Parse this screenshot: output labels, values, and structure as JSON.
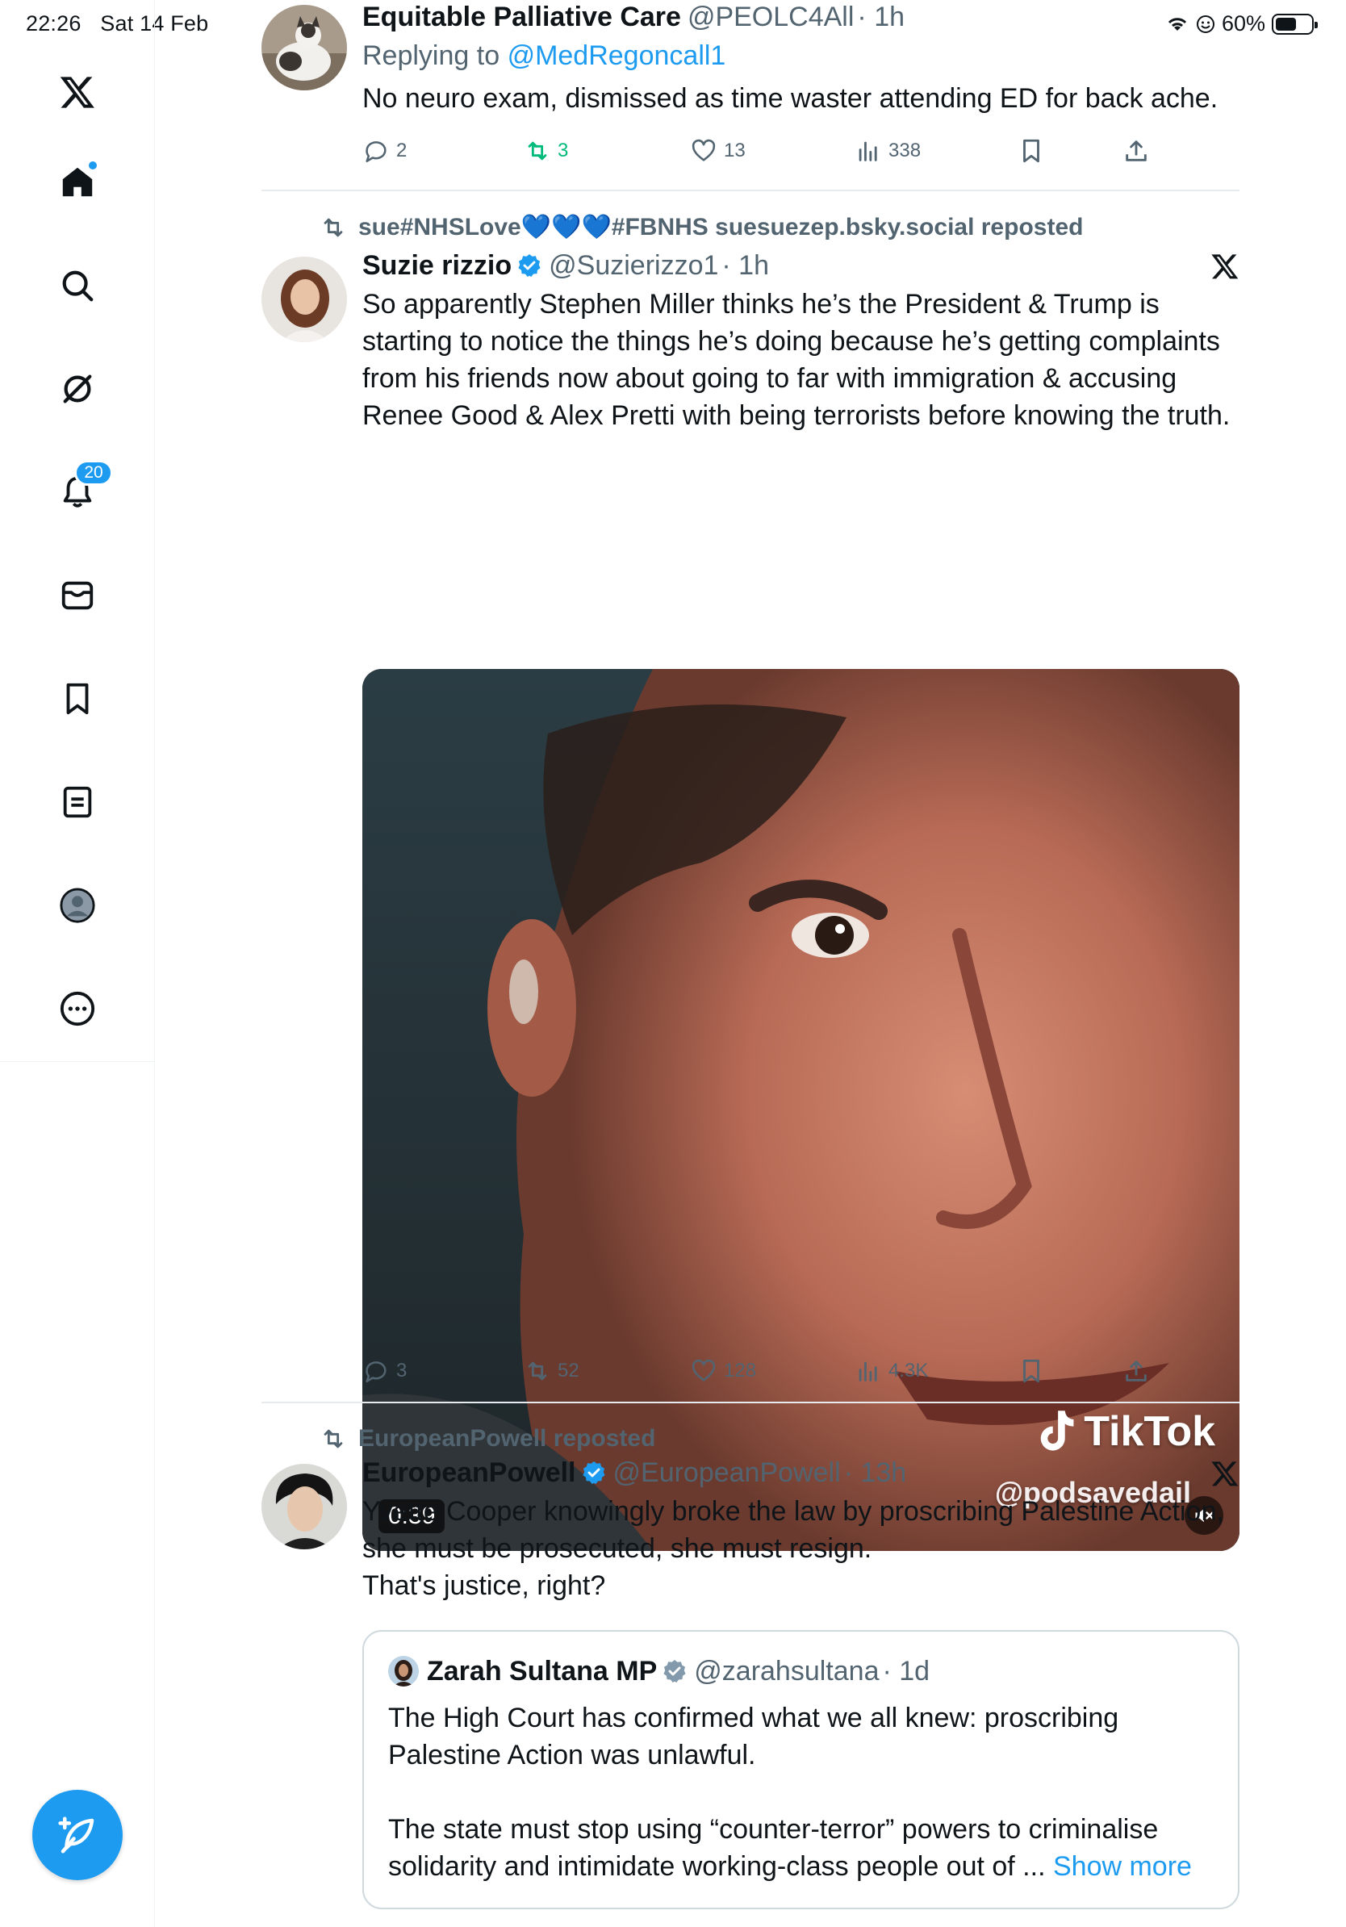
{
  "status_bar": {
    "time": "22:26",
    "date": "Sat 14 Feb",
    "battery": "60%"
  },
  "sidebar": {
    "notifications_badge": "20",
    "items": [
      {
        "name": "home-icon"
      },
      {
        "name": "search-icon"
      },
      {
        "name": "grok-icon"
      },
      {
        "name": "notifications-icon"
      },
      {
        "name": "messages-icon"
      },
      {
        "name": "bookmarks-icon"
      },
      {
        "name": "lists-icon"
      },
      {
        "name": "profile-icon"
      },
      {
        "name": "more-icon"
      }
    ]
  },
  "posts": [
    {
      "name": "Equitable Palliative Care",
      "handle": "@PEOLC4All",
      "time": "· 1h",
      "reply_prefix": "Replying to",
      "reply_to": "@MedRegoncall1",
      "text": "No neuro exam, dismissed as time waster attending ED for back ache.",
      "replies": "2",
      "reposts": "3",
      "likes": "13",
      "views": "338"
    },
    {
      "repost_label": "sue#NHSLove💙💙💙#FBNHS suesuezep.bsky.social reposted",
      "name": "Suzie rizzio",
      "handle": "@Suzierizzo1",
      "time": "· 1h",
      "text": "So apparently Stephen Miller thinks he’s the President & Trump is starting to notice the things he’s doing because he’s getting complaints from his friends now about going to far with immigration  & accusing Renee Good & Alex Pretti with being terrorists before knowing the truth.",
      "video_duration": "0:39",
      "watermark_brand": "TikTok",
      "watermark_handle": "@podsavedail",
      "replies": "3",
      "reposts": "52",
      "likes": "128",
      "views": "4.3K"
    },
    {
      "repost_label": "EuropeanPowell reposted",
      "name": "EuropeanPowell",
      "handle": "@EuropeanPowell",
      "time": "· 13h",
      "text_lines": [
        "Yvette Cooper knowingly broke the law by proscribing Palestine Action,",
        "she must be prosecuted, she must resign.",
        "That's justice, right?"
      ],
      "quote": {
        "name": "Zarah Sultana MP",
        "handle": "@zarahsultana",
        "time": "· 1d",
        "paragraph1": "The High Court has confirmed what we all knew: proscribing Palestine Action was unlawful.",
        "paragraph2": "The state must stop using “counter-terror” powers to criminalise solidarity and intimidate working-class people out of ...",
        "show_more": "Show more"
      }
    }
  ],
  "colors": {
    "accent": "#1d9bf0",
    "text": "#0f1419",
    "secondary": "#536471",
    "repost_active": "#00ba7c",
    "divider": "#e7ebed"
  }
}
